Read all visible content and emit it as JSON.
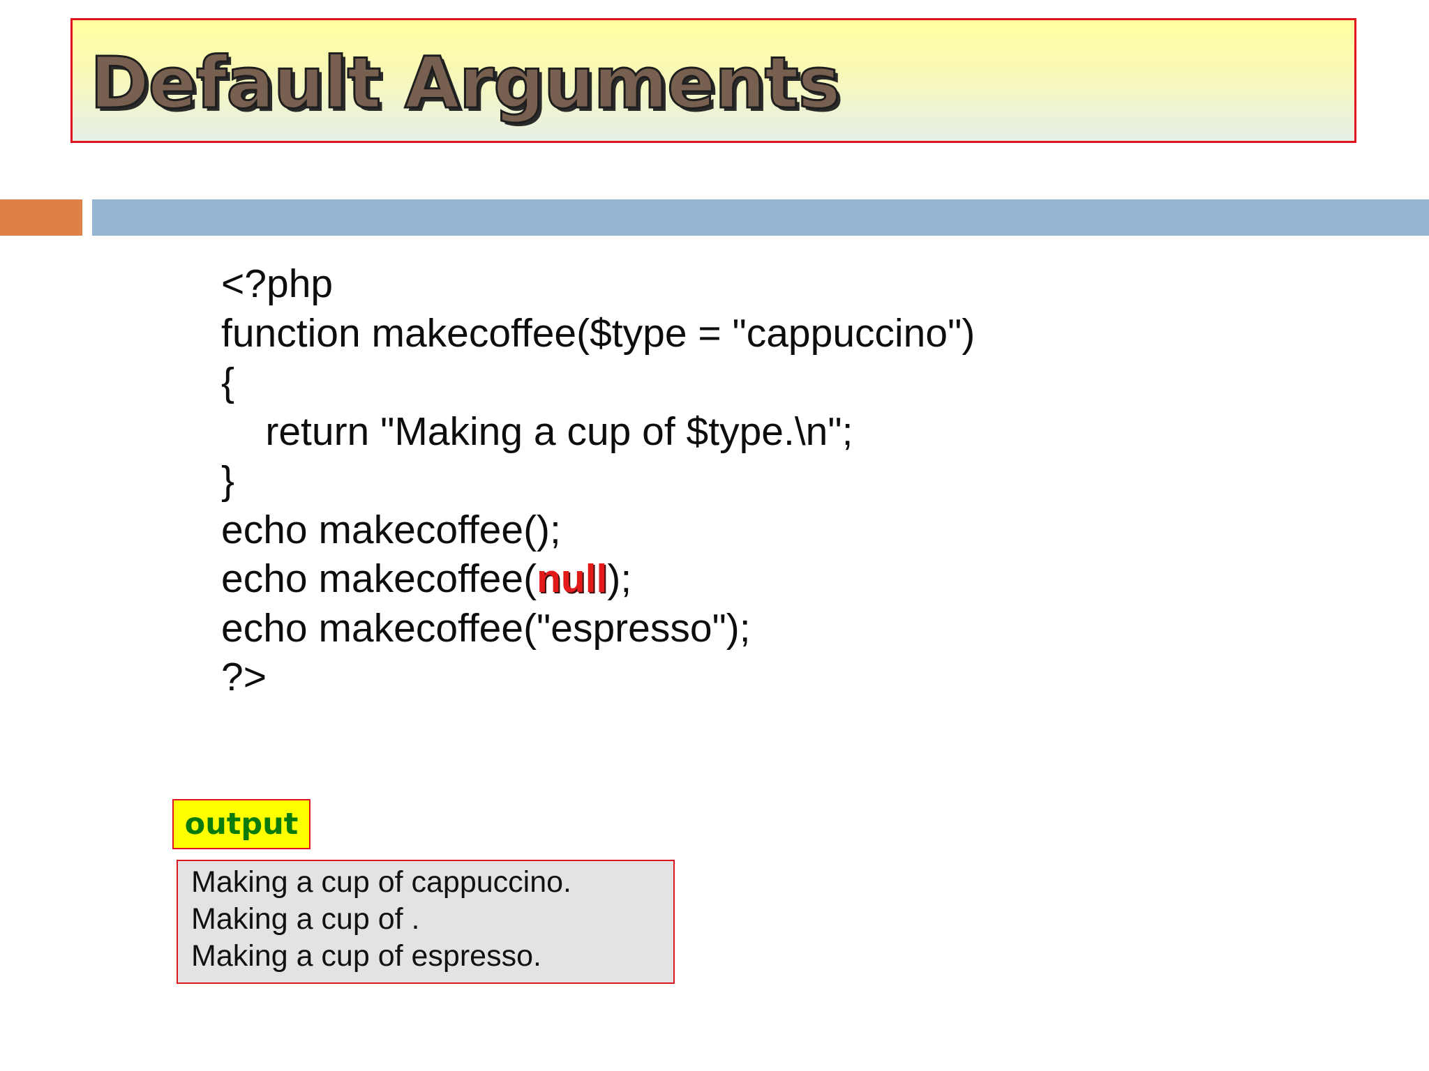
{
  "slide": {
    "title": "Default Arguments",
    "colors": {
      "title_border": "#e0141e",
      "title_fill_top": "#ffffa0",
      "accent_orange": "#df8048",
      "accent_blue": "#94b6d2",
      "null_keyword": "#e21a1a",
      "output_label_bg": "#ffff00",
      "output_label_text": "#0a7a0a",
      "output_box_bg": "#e3e3e3"
    }
  },
  "code": {
    "lines": [
      "<?php",
      "function makecoffee($type = \"cappuccino\")",
      "{",
      "    return \"Making a cup of $type.\\n\";",
      "}",
      "echo makecoffee();",
      "echo makecoffee(",
      "echo makecoffee(\"espresso\");",
      "?>"
    ],
    "null_keyword": "null",
    "null_line_suffix": ");"
  },
  "output": {
    "label": "output",
    "lines": [
      "Making a cup of cappuccino.",
      "Making a cup of .",
      "Making a cup of espresso."
    ]
  }
}
